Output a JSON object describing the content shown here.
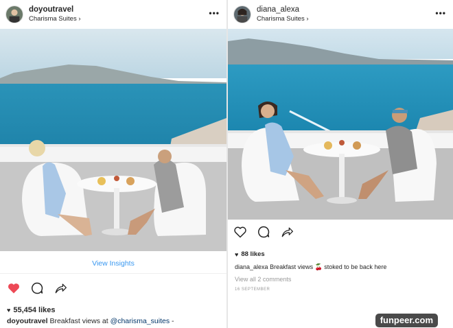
{
  "left_post": {
    "username": "doyoutravel",
    "location": "Charisma Suites ›",
    "more": "•••",
    "view_insights": "View Insights",
    "likes": "55,454 likes",
    "caption_user": "doyoutravel",
    "caption_text": "Breakfast views at",
    "caption_mention": "@charisma_suites",
    "caption_tail": "-",
    "like_active": true,
    "heart_color": "#ed4956"
  },
  "right_post": {
    "username": "diana_alexa",
    "location": "Charisma Suites ›",
    "more": "•••",
    "likes": "88 likes",
    "caption_user": "diana_alexa",
    "caption_text": "Breakfast views 🍒 stoked to be back here",
    "view_comments": "View all 2 comments",
    "date": "16 SEPTEMBER"
  },
  "icons": {
    "like": "heart-icon",
    "comment": "comment-icon",
    "share": "share-arrow-icon",
    "more": "more-options-icon"
  },
  "watermark": "funpeer.com",
  "colors": {
    "link_blue": "#3897f0",
    "heart_red": "#ed4956",
    "sea": "#1f8fb5",
    "sky": "#cfe3ee"
  }
}
